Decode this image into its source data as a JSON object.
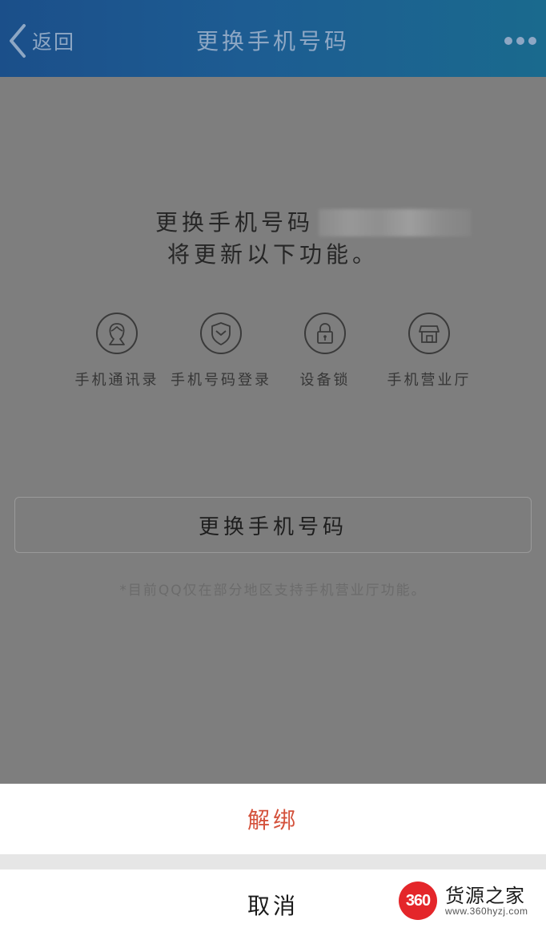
{
  "nav": {
    "back_label": "返回",
    "title": "更换手机号码",
    "more_icon": "more-dots-icon"
  },
  "main": {
    "headline_prefix": "更换手机号码",
    "headline_line2": "将更新以下功能。",
    "features": [
      {
        "label": "手机通讯录",
        "icon": "contacts-person-icon"
      },
      {
        "label": "手机号码登录",
        "icon": "phone-login-shield-icon"
      },
      {
        "label": "设备锁",
        "icon": "device-lock-icon"
      },
      {
        "label": "手机营业厅",
        "icon": "mobile-store-icon"
      }
    ],
    "change_button_label": "更换手机号码",
    "note": "*目前QQ仅在部分地区支持手机营业厅功能。"
  },
  "action_sheet": {
    "unbind_label": "解绑",
    "cancel_label": "取消"
  },
  "watermark": {
    "badge": "360",
    "name": "货源之家",
    "url": "www.360hyzj.com"
  },
  "colors": {
    "nav_background": "#1d5c92",
    "nav_text": "#8ea7c4",
    "overlay_background": "#7e7e7e",
    "unbind_text": "#d4523c",
    "watermark_badge": "#e4262a"
  }
}
